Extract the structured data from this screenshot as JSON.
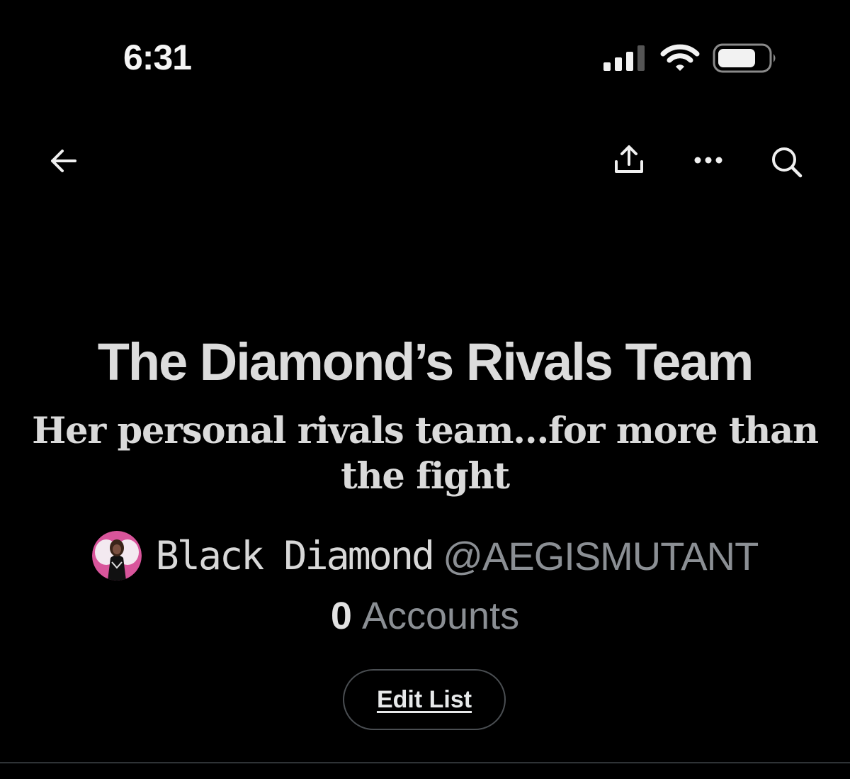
{
  "status_bar": {
    "time": "6:31",
    "icons": [
      "cellular-signal-icon",
      "wifi-icon",
      "battery-icon"
    ]
  },
  "top_nav": {
    "icons": [
      "back-arrow-icon",
      "share-icon",
      "more-options-icon",
      "search-icon"
    ]
  },
  "list": {
    "title": "The Diamond’s Rivals Team",
    "description": "Her personal rivals team…for more than the fight",
    "owner": {
      "display_name": "Black Diamond",
      "handle": "@AEGISMUTANT",
      "avatar_accent": "#d8559b"
    },
    "member_count": "0",
    "member_label": "Accounts",
    "edit_button_label": "Edit List"
  },
  "colors": {
    "background": "#000000",
    "primary_text": "#e7e9ea",
    "secondary_text": "#8b8f94",
    "button_border": "#4a4e52",
    "divider": "#2f3336"
  }
}
